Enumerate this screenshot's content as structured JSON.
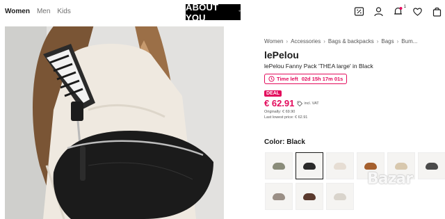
{
  "nav": {
    "links": [
      "Women",
      "Men",
      "Kids"
    ]
  },
  "logo": {
    "text": "ABOUT YOU",
    "mark": "°"
  },
  "header_icons": {
    "cart_count": "1"
  },
  "breadcrumb": [
    "Women",
    "Accessories",
    "Bags & backpacks",
    "Bags",
    "Bum..."
  ],
  "product": {
    "brand": "lePelou",
    "name": "lePelou Fanny Pack 'THEA large' in Black",
    "timer_label": "Time left",
    "timer_value": "02d 15h 17m 01s",
    "deal_badge": "DEAL",
    "price": "€ 62.91",
    "vat_note": "incl. VAT",
    "original_price": "Originally: € 69.90",
    "lowest_price": "Last lowest price: € 62.91"
  },
  "color": {
    "label": "Color:",
    "value": "Black",
    "swatch_colors": [
      "#8a8c7a",
      "#2a2a2a",
      "#e6ddd3",
      "#a5602e",
      "#d8c8ae",
      "#4a4a4a",
      "#9a8f86",
      "#5a3a2e",
      "#d9d4cc"
    ]
  },
  "watermark": "Bazar"
}
